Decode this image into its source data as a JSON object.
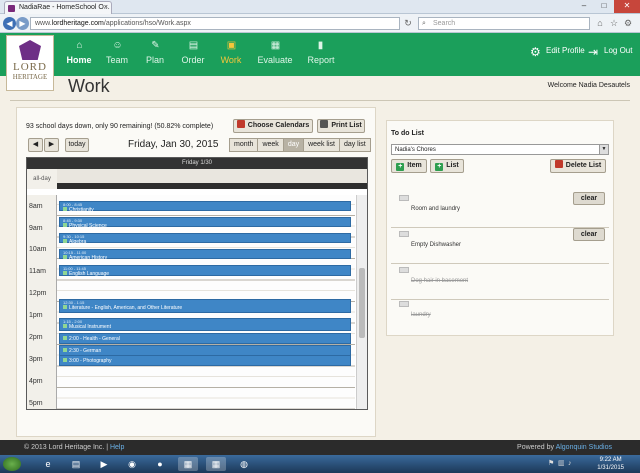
{
  "browser": {
    "tab_title": "NadiaRae - HomeSchool O...",
    "url_prefix": "www.",
    "url_domain": "lordheritage.com",
    "url_path": "/applications/hso/Work.aspx",
    "search_placeholder": "Search"
  },
  "header": {
    "logo_line1": "LORD",
    "logo_line2": "HERITAGE",
    "nav": [
      {
        "label": "Home",
        "icon": "home-icon"
      },
      {
        "label": "Team",
        "icon": "team-icon"
      },
      {
        "label": "Plan",
        "icon": "plan-icon"
      },
      {
        "label": "Order",
        "icon": "cart-icon"
      },
      {
        "label": "Work",
        "icon": "briefcase-icon"
      },
      {
        "label": "Evaluate",
        "icon": "evaluate-icon"
      },
      {
        "label": "Report",
        "icon": "chart-icon"
      }
    ],
    "edit_profile": "Edit Profile",
    "log_out": "Log Out"
  },
  "page": {
    "title": "Work",
    "welcome": "Welcome Nadia Desautels"
  },
  "calendar": {
    "status": "93 school days down, only 90 remaining! (50.82% complete)",
    "choose_calendars": "Choose Calendars",
    "print_list": "Print List",
    "today": "today",
    "date": "Friday, Jan 30, 2015",
    "views": [
      "month",
      "week",
      "day",
      "week list",
      "day list"
    ],
    "active_view": "day",
    "column_header": "Friday 1/30",
    "allday_label": "all-day",
    "hours": [
      "8am",
      "9am",
      "10am",
      "11am",
      "12pm",
      "1pm",
      "2pm",
      "3pm",
      "4pm",
      "5pm"
    ],
    "events": [
      {
        "time": "8:00 - 8:45",
        "name": "Christianity"
      },
      {
        "time": "8:45 - 9:30",
        "name": "Physical Science"
      },
      {
        "time": "9:30 - 10:15",
        "name": "Algebra"
      },
      {
        "time": "10:15 - 11:00",
        "name": "American History"
      },
      {
        "time": "11:00 - 11:45",
        "name": "English Language"
      },
      {
        "time": "12:30 - 1:15",
        "name": "Literature - English, American, and Other Literature"
      },
      {
        "time": "1:15 - 2:00",
        "name": "Musical Instrument"
      },
      {
        "time": "",
        "name": "2:00 - Health - General"
      },
      {
        "time": "",
        "name": "2:30 - German"
      },
      {
        "time": "",
        "name": "3:00 - Photography"
      }
    ]
  },
  "todo": {
    "title": "To do List",
    "selected_list": "Nadia's Chores",
    "add_item": "Item",
    "add_list": "List",
    "delete_list": "Delete List",
    "items": [
      {
        "label": "Room and laundry",
        "done": false,
        "clear": "clear"
      },
      {
        "label": "Empty Dishwasher",
        "done": false,
        "clear": "clear"
      },
      {
        "label": "Dog hair in basement",
        "done": true,
        "clear": ""
      },
      {
        "label": "laundry",
        "done": true,
        "clear": ""
      }
    ]
  },
  "footer": {
    "copyright": "© 2013 Lord Heritage Inc. |",
    "help": "Help",
    "powered_by": "Powered by",
    "studio": "Algonquin Studios"
  },
  "taskbar": {
    "time": "9:22 AM",
    "date": "1/31/2015"
  },
  "colors": {
    "header_green": "#1b9f5b",
    "active_nav": "#f6c63a",
    "event_blue": "#3f86c6"
  }
}
